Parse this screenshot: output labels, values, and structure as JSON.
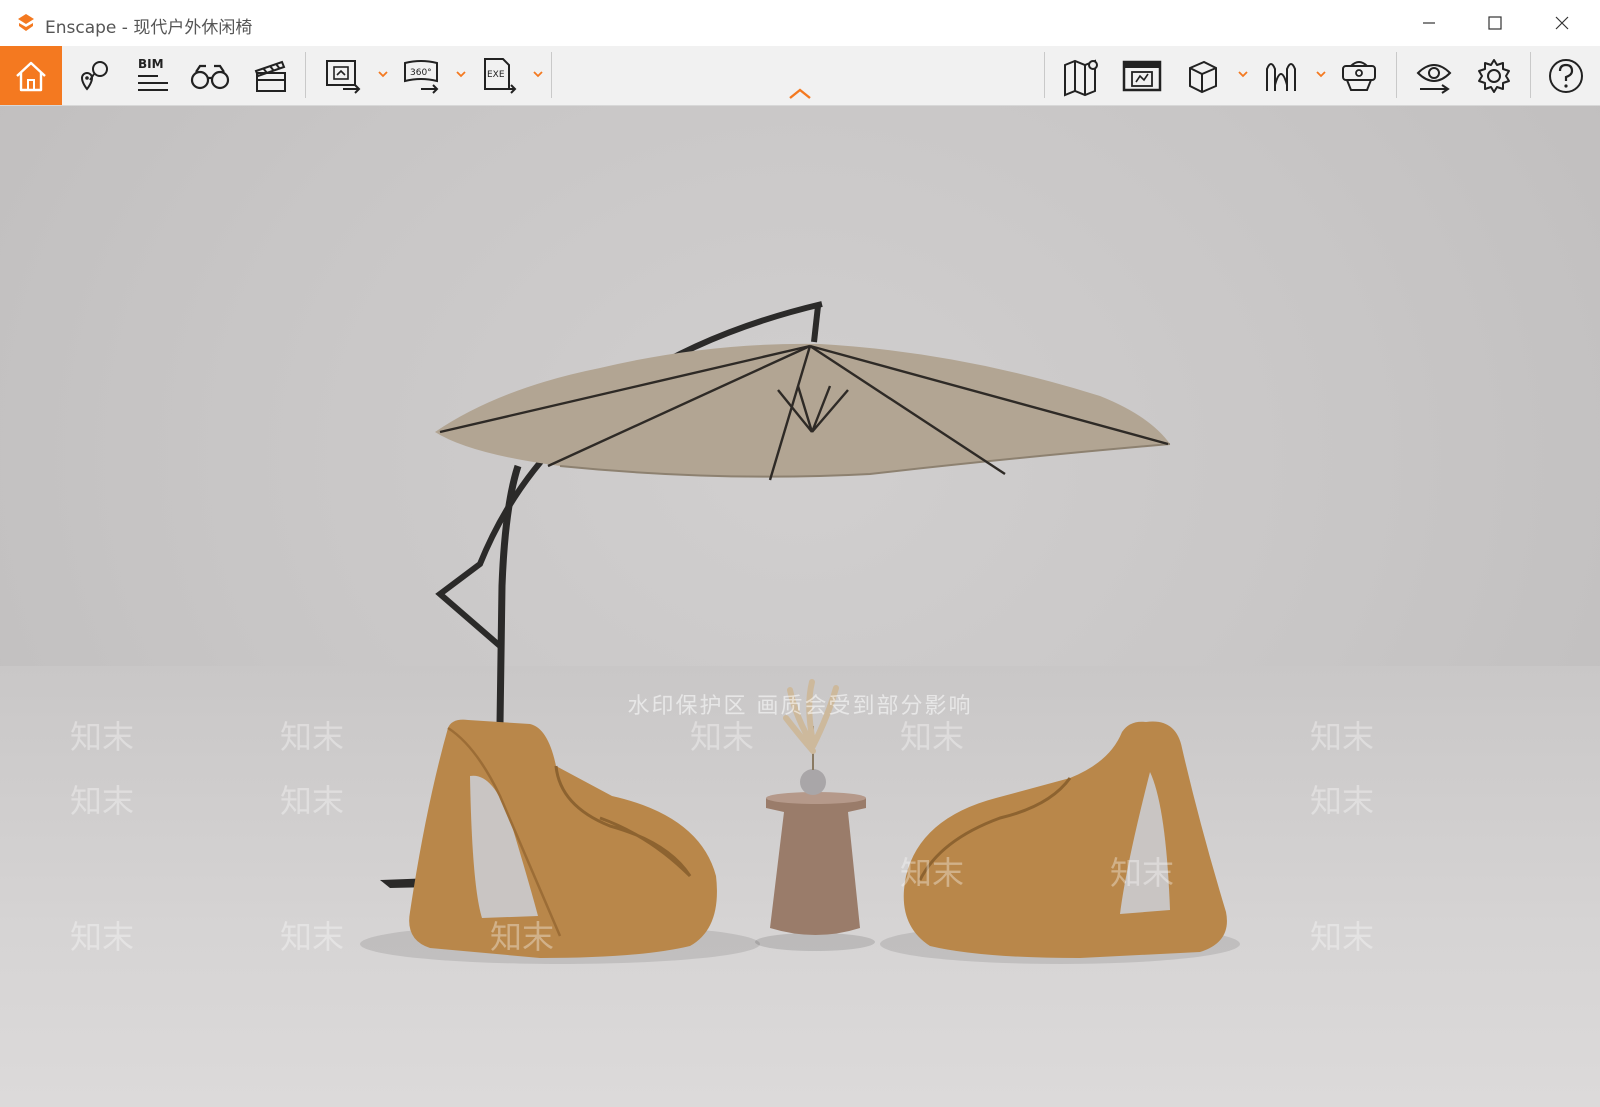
{
  "window": {
    "title": "Enscape - 现代户外休闲椅",
    "controls": [
      "minimize-icon",
      "maximize-icon",
      "close-icon"
    ]
  },
  "toolbar": {
    "left": [
      {
        "name": "home",
        "icon": "home-icon",
        "active": true
      },
      {
        "name": "views",
        "icon": "location-views-icon"
      },
      {
        "name": "bim",
        "icon": "bim-icon",
        "label": "BIM"
      },
      {
        "name": "assets",
        "icon": "binoculars-icon"
      },
      {
        "name": "video-editor",
        "icon": "clapperboard-icon"
      }
    ],
    "export": [
      {
        "name": "render-image",
        "icon": "render-image-icon"
      },
      {
        "name": "render-panorama",
        "icon": "panorama-360-icon",
        "label": "360°"
      },
      {
        "name": "export-exe",
        "icon": "export-exe-icon",
        "label": "EXE"
      }
    ],
    "right": [
      {
        "name": "map",
        "icon": "map-icon"
      },
      {
        "name": "material-editor",
        "icon": "material-editor-icon"
      },
      {
        "name": "cube-view",
        "icon": "cube-icon"
      },
      {
        "name": "walk-mode",
        "icon": "walk-icon"
      },
      {
        "name": "vr-headset",
        "icon": "vr-headset-icon"
      },
      {
        "name": "visual-settings-eye",
        "icon": "eye-icon"
      },
      {
        "name": "settings",
        "icon": "gear-icon"
      },
      {
        "name": "help",
        "icon": "help-icon"
      }
    ],
    "accent": "#f47920"
  },
  "viewport": {
    "watermark_text": "水印保护区 画质会受到部分影响",
    "watermark_logo": "知末"
  }
}
